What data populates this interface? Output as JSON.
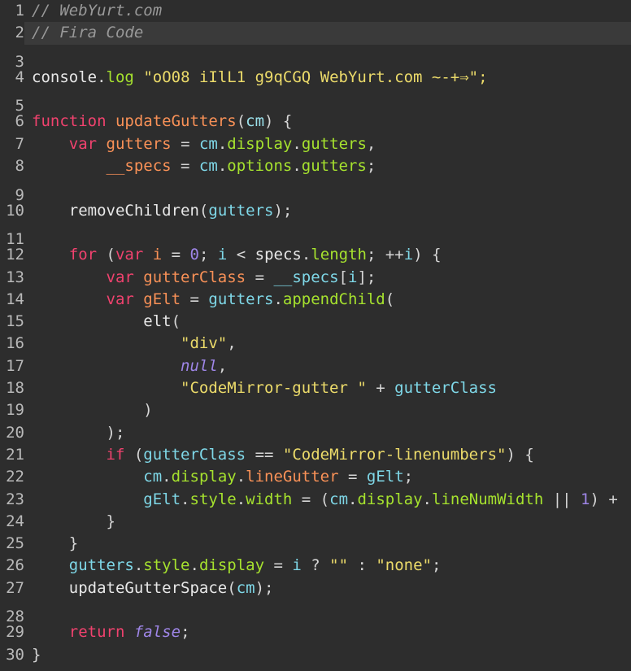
{
  "editor": {
    "name": "code-editor",
    "theme_name": "dark",
    "background_color": "#2d2d2d",
    "active_line_background": "#3a3a3a",
    "gutter_color": "#b9b9b9",
    "font_size_px": 19,
    "line_height_px": 27.3,
    "total_lines": 30,
    "active_line": 2,
    "colors": {
      "comment": "#999999",
      "keyword": "#f0426e",
      "function": "#f99157",
      "variable": "#f99157",
      "property": "#a6e22e",
      "identifier": "#6ec2e8",
      "string": "#ecdb6a",
      "number": "#9f86e8",
      "constant": "#9f86e8",
      "plain": "#e8e8e8"
    }
  },
  "lines": [
    {
      "number": "1",
      "active": false,
      "tokens": [
        {
          "text": "// WebYurt.com",
          "cls": "t-comment"
        }
      ]
    },
    {
      "number": "2",
      "active": true,
      "tokens": [
        {
          "text": "// Fira Code",
          "cls": "t-comment"
        }
      ]
    },
    {
      "number": "3",
      "active": false,
      "tokens": []
    },
    {
      "number": "4",
      "active": false,
      "tokens": [
        {
          "text": "console",
          "cls": "t-plain"
        },
        {
          "text": ".",
          "cls": "t-punct"
        },
        {
          "text": "log",
          "cls": "t-prop"
        },
        {
          "text": " ",
          "cls": "t-plain"
        },
        {
          "text": "\"oO08 iIlL1 g9qCGQ WebYurt.com ~-+⇒\";",
          "cls": "t-string"
        }
      ]
    },
    {
      "number": "5",
      "active": false,
      "tokens": []
    },
    {
      "number": "6",
      "active": false,
      "tokens": [
        {
          "text": "function",
          "cls": "t-keyword"
        },
        {
          "text": " ",
          "cls": "t-plain"
        },
        {
          "text": "updateGutters",
          "cls": "t-func"
        },
        {
          "text": "(",
          "cls": "t-punct"
        },
        {
          "text": "cm",
          "cls": "t-param"
        },
        {
          "text": ")",
          "cls": "t-punct"
        },
        {
          "text": " {",
          "cls": "t-punct"
        }
      ]
    },
    {
      "number": "7",
      "active": false,
      "tokens": [
        {
          "text": "    ",
          "cls": "t-plain"
        },
        {
          "text": "var",
          "cls": "t-keyword"
        },
        {
          "text": " ",
          "cls": "t-plain"
        },
        {
          "text": "gutters",
          "cls": "t-var"
        },
        {
          "text": " = ",
          "cls": "t-op"
        },
        {
          "text": "cm",
          "cls": "t-cyan"
        },
        {
          "text": ".",
          "cls": "t-punct"
        },
        {
          "text": "display",
          "cls": "t-prop"
        },
        {
          "text": ".",
          "cls": "t-punct"
        },
        {
          "text": "gutters",
          "cls": "t-prop"
        },
        {
          "text": ",",
          "cls": "t-punct"
        }
      ]
    },
    {
      "number": "8",
      "active": false,
      "tokens": [
        {
          "text": "        ",
          "cls": "t-plain"
        },
        {
          "text": "__specs",
          "cls": "t-var"
        },
        {
          "text": " = ",
          "cls": "t-op"
        },
        {
          "text": "cm",
          "cls": "t-cyan"
        },
        {
          "text": ".",
          "cls": "t-punct"
        },
        {
          "text": "options",
          "cls": "t-prop"
        },
        {
          "text": ".",
          "cls": "t-punct"
        },
        {
          "text": "gutters",
          "cls": "t-prop"
        },
        {
          "text": ";",
          "cls": "t-punct"
        }
      ]
    },
    {
      "number": "9",
      "active": false,
      "tokens": []
    },
    {
      "number": "10",
      "active": false,
      "tokens": [
        {
          "text": "    ",
          "cls": "t-plain"
        },
        {
          "text": "removeChildren",
          "cls": "t-plain"
        },
        {
          "text": "(",
          "cls": "t-punct"
        },
        {
          "text": "gutters",
          "cls": "t-cyan"
        },
        {
          "text": ");",
          "cls": "t-punct"
        }
      ]
    },
    {
      "number": "11",
      "active": false,
      "tokens": []
    },
    {
      "number": "12",
      "active": false,
      "tokens": [
        {
          "text": "    ",
          "cls": "t-plain"
        },
        {
          "text": "for",
          "cls": "t-keyword"
        },
        {
          "text": " (",
          "cls": "t-punct"
        },
        {
          "text": "var",
          "cls": "t-keyword"
        },
        {
          "text": " ",
          "cls": "t-plain"
        },
        {
          "text": "i",
          "cls": "t-var"
        },
        {
          "text": " = ",
          "cls": "t-op"
        },
        {
          "text": "0",
          "cls": "t-number"
        },
        {
          "text": "; ",
          "cls": "t-punct"
        },
        {
          "text": "i",
          "cls": "t-cyan"
        },
        {
          "text": " < ",
          "cls": "t-op"
        },
        {
          "text": "specs",
          "cls": "t-plain"
        },
        {
          "text": ".",
          "cls": "t-punct"
        },
        {
          "text": "length",
          "cls": "t-prop"
        },
        {
          "text": "; ",
          "cls": "t-punct"
        },
        {
          "text": "++",
          "cls": "t-op"
        },
        {
          "text": "i",
          "cls": "t-cyan"
        },
        {
          "text": ") {",
          "cls": "t-punct"
        }
      ]
    },
    {
      "number": "13",
      "active": false,
      "tokens": [
        {
          "text": "        ",
          "cls": "t-plain"
        },
        {
          "text": "var",
          "cls": "t-keyword"
        },
        {
          "text": " ",
          "cls": "t-plain"
        },
        {
          "text": "gutterClass",
          "cls": "t-var"
        },
        {
          "text": " = ",
          "cls": "t-op"
        },
        {
          "text": "__specs",
          "cls": "t-cyan"
        },
        {
          "text": "[",
          "cls": "t-punct"
        },
        {
          "text": "i",
          "cls": "t-cyan"
        },
        {
          "text": "];",
          "cls": "t-punct"
        }
      ]
    },
    {
      "number": "14",
      "active": false,
      "tokens": [
        {
          "text": "        ",
          "cls": "t-plain"
        },
        {
          "text": "var",
          "cls": "t-keyword"
        },
        {
          "text": " ",
          "cls": "t-plain"
        },
        {
          "text": "gElt",
          "cls": "t-var"
        },
        {
          "text": " = ",
          "cls": "t-op"
        },
        {
          "text": "gutters",
          "cls": "t-cyan"
        },
        {
          "text": ".",
          "cls": "t-punct"
        },
        {
          "text": "appendChild",
          "cls": "t-prop"
        },
        {
          "text": "(",
          "cls": "t-punct"
        }
      ]
    },
    {
      "number": "15",
      "active": false,
      "tokens": [
        {
          "text": "            ",
          "cls": "t-plain"
        },
        {
          "text": "elt",
          "cls": "t-plain"
        },
        {
          "text": "(",
          "cls": "t-punct"
        }
      ]
    },
    {
      "number": "16",
      "active": false,
      "tokens": [
        {
          "text": "                ",
          "cls": "t-plain"
        },
        {
          "text": "\"div\"",
          "cls": "t-string"
        },
        {
          "text": ",",
          "cls": "t-punct"
        }
      ]
    },
    {
      "number": "17",
      "active": false,
      "tokens": [
        {
          "text": "                ",
          "cls": "t-plain"
        },
        {
          "text": "null",
          "cls": "t-const"
        },
        {
          "text": ",",
          "cls": "t-punct"
        }
      ]
    },
    {
      "number": "18",
      "active": false,
      "tokens": [
        {
          "text": "                ",
          "cls": "t-plain"
        },
        {
          "text": "\"CodeMirror-gutter \"",
          "cls": "t-string"
        },
        {
          "text": " + ",
          "cls": "t-op"
        },
        {
          "text": "gutterClass",
          "cls": "t-cyan"
        }
      ]
    },
    {
      "number": "19",
      "active": false,
      "tokens": [
        {
          "text": "            )",
          "cls": "t-punct"
        }
      ]
    },
    {
      "number": "20",
      "active": false,
      "tokens": [
        {
          "text": "        );",
          "cls": "t-punct"
        }
      ]
    },
    {
      "number": "21",
      "active": false,
      "tokens": [
        {
          "text": "        ",
          "cls": "t-plain"
        },
        {
          "text": "if",
          "cls": "t-keyword"
        },
        {
          "text": " (",
          "cls": "t-punct"
        },
        {
          "text": "gutterClass",
          "cls": "t-cyan"
        },
        {
          "text": " == ",
          "cls": "t-op"
        },
        {
          "text": "\"CodeMirror-linenumbers\"",
          "cls": "t-string"
        },
        {
          "text": ") {",
          "cls": "t-punct"
        }
      ]
    },
    {
      "number": "22",
      "active": false,
      "tokens": [
        {
          "text": "            ",
          "cls": "t-plain"
        },
        {
          "text": "cm",
          "cls": "t-cyan"
        },
        {
          "text": ".",
          "cls": "t-punct"
        },
        {
          "text": "display",
          "cls": "t-prop"
        },
        {
          "text": ".",
          "cls": "t-punct"
        },
        {
          "text": "lineGutter",
          "cls": "t-var"
        },
        {
          "text": " = ",
          "cls": "t-op"
        },
        {
          "text": "gElt",
          "cls": "t-cyan"
        },
        {
          "text": ";",
          "cls": "t-punct"
        }
      ]
    },
    {
      "number": "23",
      "active": false,
      "tokens": [
        {
          "text": "            ",
          "cls": "t-plain"
        },
        {
          "text": "gElt",
          "cls": "t-cyan"
        },
        {
          "text": ".",
          "cls": "t-punct"
        },
        {
          "text": "style",
          "cls": "t-prop"
        },
        {
          "text": ".",
          "cls": "t-punct"
        },
        {
          "text": "width",
          "cls": "t-prop"
        },
        {
          "text": " = (",
          "cls": "t-op"
        },
        {
          "text": "cm",
          "cls": "t-cyan"
        },
        {
          "text": ".",
          "cls": "t-punct"
        },
        {
          "text": "display",
          "cls": "t-prop"
        },
        {
          "text": ".",
          "cls": "t-punct"
        },
        {
          "text": "lineNumWidth",
          "cls": "t-prop"
        },
        {
          "text": " || ",
          "cls": "t-op"
        },
        {
          "text": "1",
          "cls": "t-number"
        },
        {
          "text": ") +",
          "cls": "t-punct"
        }
      ]
    },
    {
      "number": "24",
      "active": false,
      "tokens": [
        {
          "text": "        }",
          "cls": "t-punct"
        }
      ]
    },
    {
      "number": "25",
      "active": false,
      "tokens": [
        {
          "text": "    }",
          "cls": "t-punct"
        }
      ]
    },
    {
      "number": "26",
      "active": false,
      "tokens": [
        {
          "text": "    ",
          "cls": "t-plain"
        },
        {
          "text": "gutters",
          "cls": "t-cyan"
        },
        {
          "text": ".",
          "cls": "t-punct"
        },
        {
          "text": "style",
          "cls": "t-prop"
        },
        {
          "text": ".",
          "cls": "t-punct"
        },
        {
          "text": "display",
          "cls": "t-prop"
        },
        {
          "text": " = ",
          "cls": "t-op"
        },
        {
          "text": "i",
          "cls": "t-cyan"
        },
        {
          "text": " ? ",
          "cls": "t-op"
        },
        {
          "text": "\"\"",
          "cls": "t-string"
        },
        {
          "text": " : ",
          "cls": "t-op"
        },
        {
          "text": "\"none\"",
          "cls": "t-string"
        },
        {
          "text": ";",
          "cls": "t-punct"
        }
      ]
    },
    {
      "number": "27",
      "active": false,
      "tokens": [
        {
          "text": "    ",
          "cls": "t-plain"
        },
        {
          "text": "updateGutterSpace",
          "cls": "t-plain"
        },
        {
          "text": "(",
          "cls": "t-punct"
        },
        {
          "text": "cm",
          "cls": "t-cyan"
        },
        {
          "text": ");",
          "cls": "t-punct"
        }
      ]
    },
    {
      "number": "28",
      "active": false,
      "tokens": []
    },
    {
      "number": "29",
      "active": false,
      "tokens": [
        {
          "text": "    ",
          "cls": "t-plain"
        },
        {
          "text": "return",
          "cls": "t-keyword"
        },
        {
          "text": " ",
          "cls": "t-plain"
        },
        {
          "text": "false",
          "cls": "t-const"
        },
        {
          "text": ";",
          "cls": "t-punct"
        }
      ]
    },
    {
      "number": "30",
      "active": false,
      "tokens": [
        {
          "text": "}",
          "cls": "t-punct"
        }
      ]
    }
  ]
}
